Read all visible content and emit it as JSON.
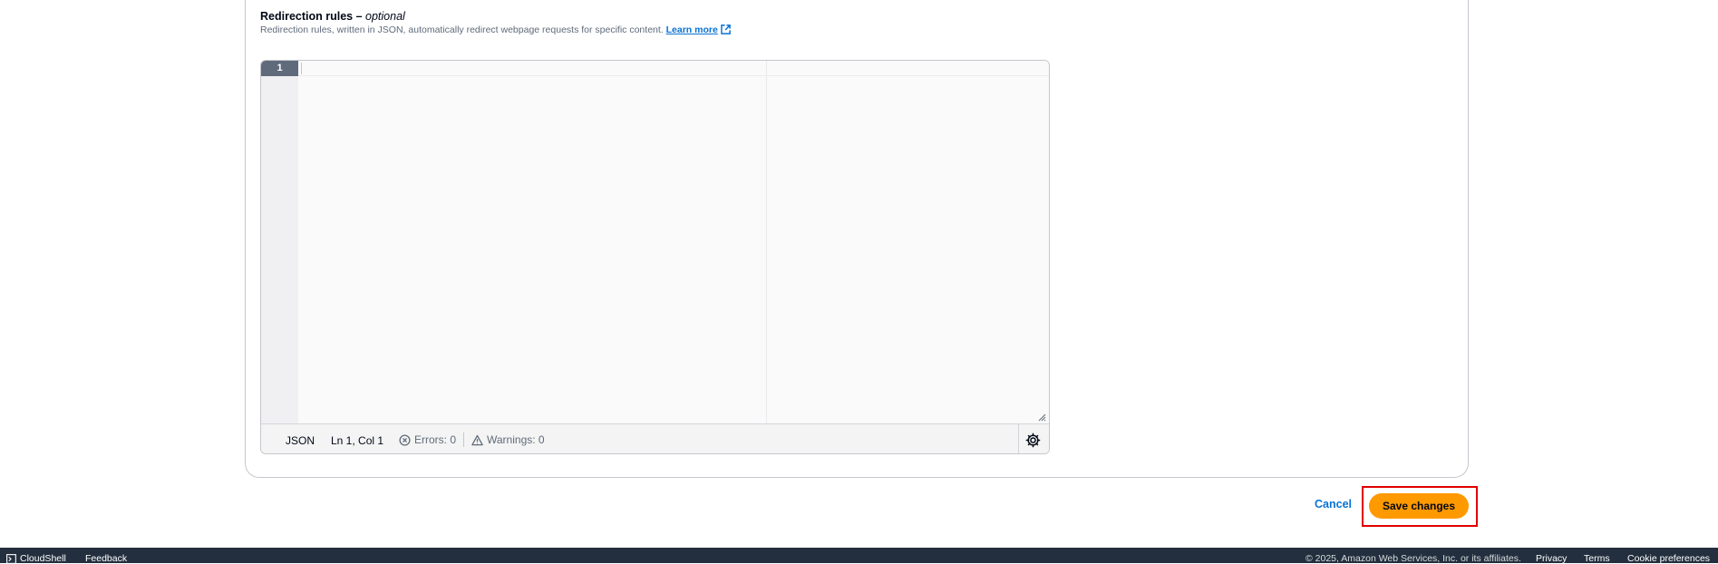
{
  "field": {
    "label": "Redirection rules",
    "label_suffix": " – ",
    "optional": "optional",
    "description": "Redirection rules, written in JSON, automatically redirect webpage requests for specific content.",
    "learn_more": "Learn more"
  },
  "editor": {
    "line_number": "1",
    "language": "JSON",
    "position": "Ln 1, Col 1",
    "errors": "Errors: 0",
    "warnings": "Warnings: 0"
  },
  "actions": {
    "cancel": "Cancel",
    "save": "Save changes"
  },
  "footer": {
    "cloudshell": "CloudShell",
    "feedback": "Feedback",
    "copyright": "© 2025, Amazon Web Services, Inc. or its affiliates.",
    "privacy": "Privacy",
    "terms": "Terms",
    "cookie": "Cookie preferences"
  },
  "colors": {
    "primary_button": "#ff9900",
    "link": "#0972d3",
    "footer_bg": "#232f3e",
    "highlight": "#e00000"
  }
}
